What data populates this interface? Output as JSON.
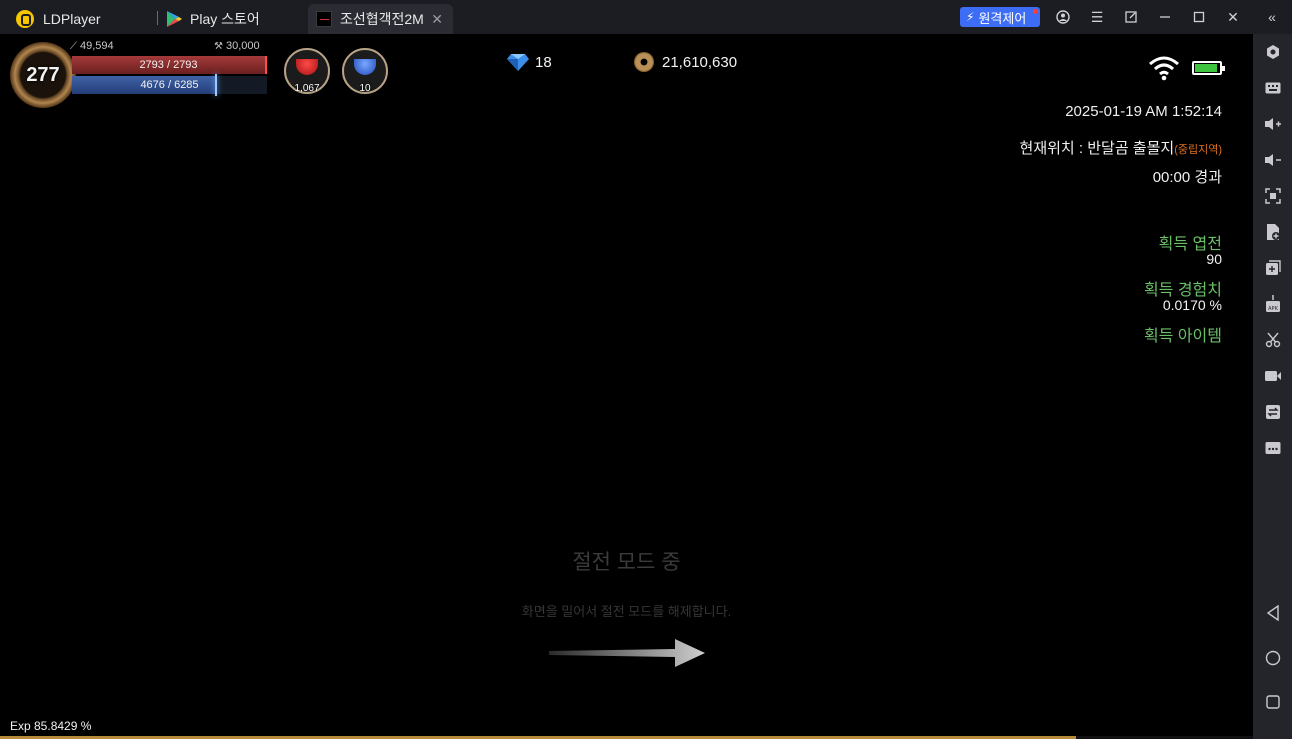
{
  "titlebar": {
    "tabs": [
      {
        "label": "LDPlayer"
      },
      {
        "label": "Play 스토어"
      },
      {
        "label": "조선협객전2M"
      }
    ],
    "remote_label": "원격제어"
  },
  "sidebar": {
    "icons": [
      "settings-hex-icon",
      "keyboard-icon",
      "volume-up-icon",
      "volume-down-icon",
      "fullscreen-icon",
      "add-apk-icon",
      "multi-instance-icon",
      "install-apk-icon",
      "scissors-icon",
      "record-video-icon",
      "sync-icon",
      "more-icon",
      "back-icon",
      "home-icon",
      "recent-apps-icon"
    ]
  },
  "hud": {
    "level": "277",
    "attack": "49,594",
    "defense": "30,000",
    "hp_text": "2793 / 2793",
    "hp_fraction": 1.0,
    "mp_text": "4676 / 6285",
    "mp_fraction": 0.744,
    "red_potion_count": "1,067",
    "blue_potion_count": "10",
    "diamonds": "18",
    "gold": "21,610,630",
    "battery_fraction": 0.9
  },
  "info": {
    "datetime": "2025-01-19 AM 1:52:14",
    "location_label": "현재위치 : 반달곰 출몰지",
    "location_zone": "(중립지역)",
    "elapsed": "00:00 경과",
    "gain_coins_label": "획득 엽전",
    "gain_coins_value": "90",
    "gain_exp_label": "획득 경험치",
    "gain_exp_value": "0.0170 %",
    "gain_items_label": "획득 아이템"
  },
  "power_saving": {
    "title": "절전 모드 중",
    "subtitle": "화면을 밀어서 절전 모드를 해제합니다."
  },
  "exp": {
    "text": "Exp 85.8429 %",
    "fraction": 0.858429
  },
  "colors": {
    "remote_button": "#3d6df5",
    "gain_label": "#6bbf67",
    "neutral_zone": "#e0701e"
  }
}
